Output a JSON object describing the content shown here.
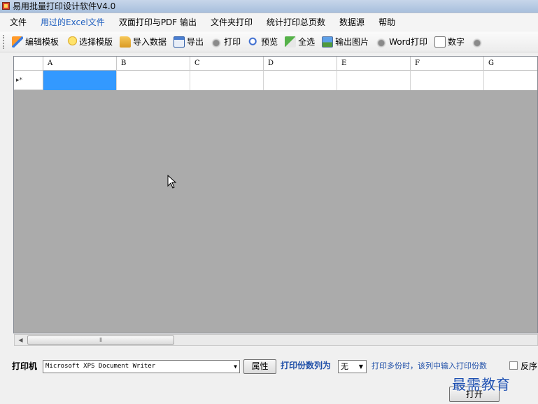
{
  "window": {
    "title": "易用批量打印设计软件V4.0"
  },
  "menu": {
    "items": [
      {
        "label": "文件",
        "active": false
      },
      {
        "label": "用过的Excel文件",
        "active": true
      },
      {
        "label": "双面打印与PDF 输出",
        "active": false
      },
      {
        "label": "文件夹打印",
        "active": false
      },
      {
        "label": "统计打印总页数",
        "active": false
      },
      {
        "label": "数据源",
        "active": false
      },
      {
        "label": "帮助",
        "active": false
      }
    ]
  },
  "toolbar": {
    "edit_template": "编辑模板",
    "select_template": "选择模版",
    "import_data": "导入数据",
    "export": "导出",
    "print": "打印",
    "preview": "预览",
    "select_all": "全选",
    "export_image": "输出图片",
    "word_print": "Word打印",
    "number": "数字"
  },
  "grid": {
    "columns": [
      "A",
      "B",
      "C",
      "D",
      "E",
      "F",
      "G"
    ],
    "row_marker": "▸*"
  },
  "bottom": {
    "printer_label": "打印机",
    "printer_value": "Microsoft XPS Document Writer",
    "properties_button": "属性",
    "copies_label": "打印份数列为",
    "copies_value": "无",
    "copies_hint": "打印多份时，该列中输入打印份数",
    "reverse_label": "反序",
    "open_button": "打开"
  },
  "watermark": "最需教育",
  "colors": {
    "selection": "#3399ff",
    "grid_background": "#ababab",
    "link_blue": "#1f4fa8"
  }
}
